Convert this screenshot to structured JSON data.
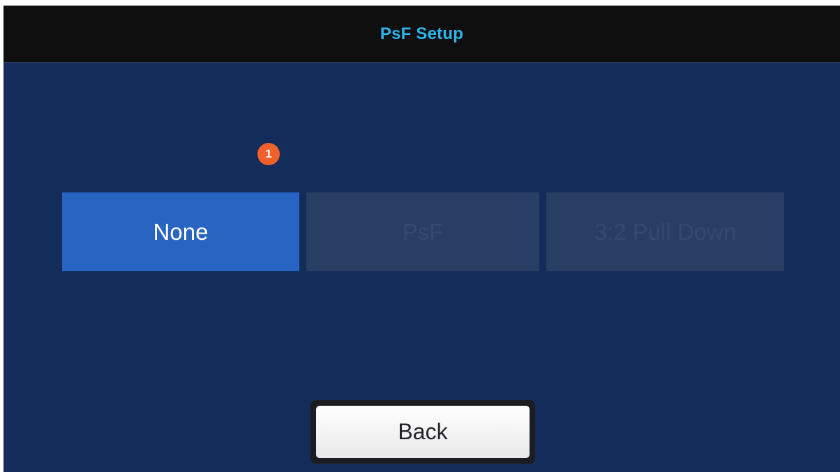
{
  "header": {
    "title": "PsF Setup"
  },
  "badge": {
    "count": "1"
  },
  "options": {
    "none": {
      "label": "None",
      "state": "selected"
    },
    "psf": {
      "label": "PsF",
      "state": "disabled"
    },
    "pulldown": {
      "label": "3:2 Pull Down",
      "state": "disabled"
    }
  },
  "footer": {
    "back_label": "Back"
  },
  "colors": {
    "title": "#2ab6ea",
    "background": "#132c5a",
    "selected": "#2865c2",
    "disabled": "#293e63",
    "badge": "#f0602a"
  }
}
